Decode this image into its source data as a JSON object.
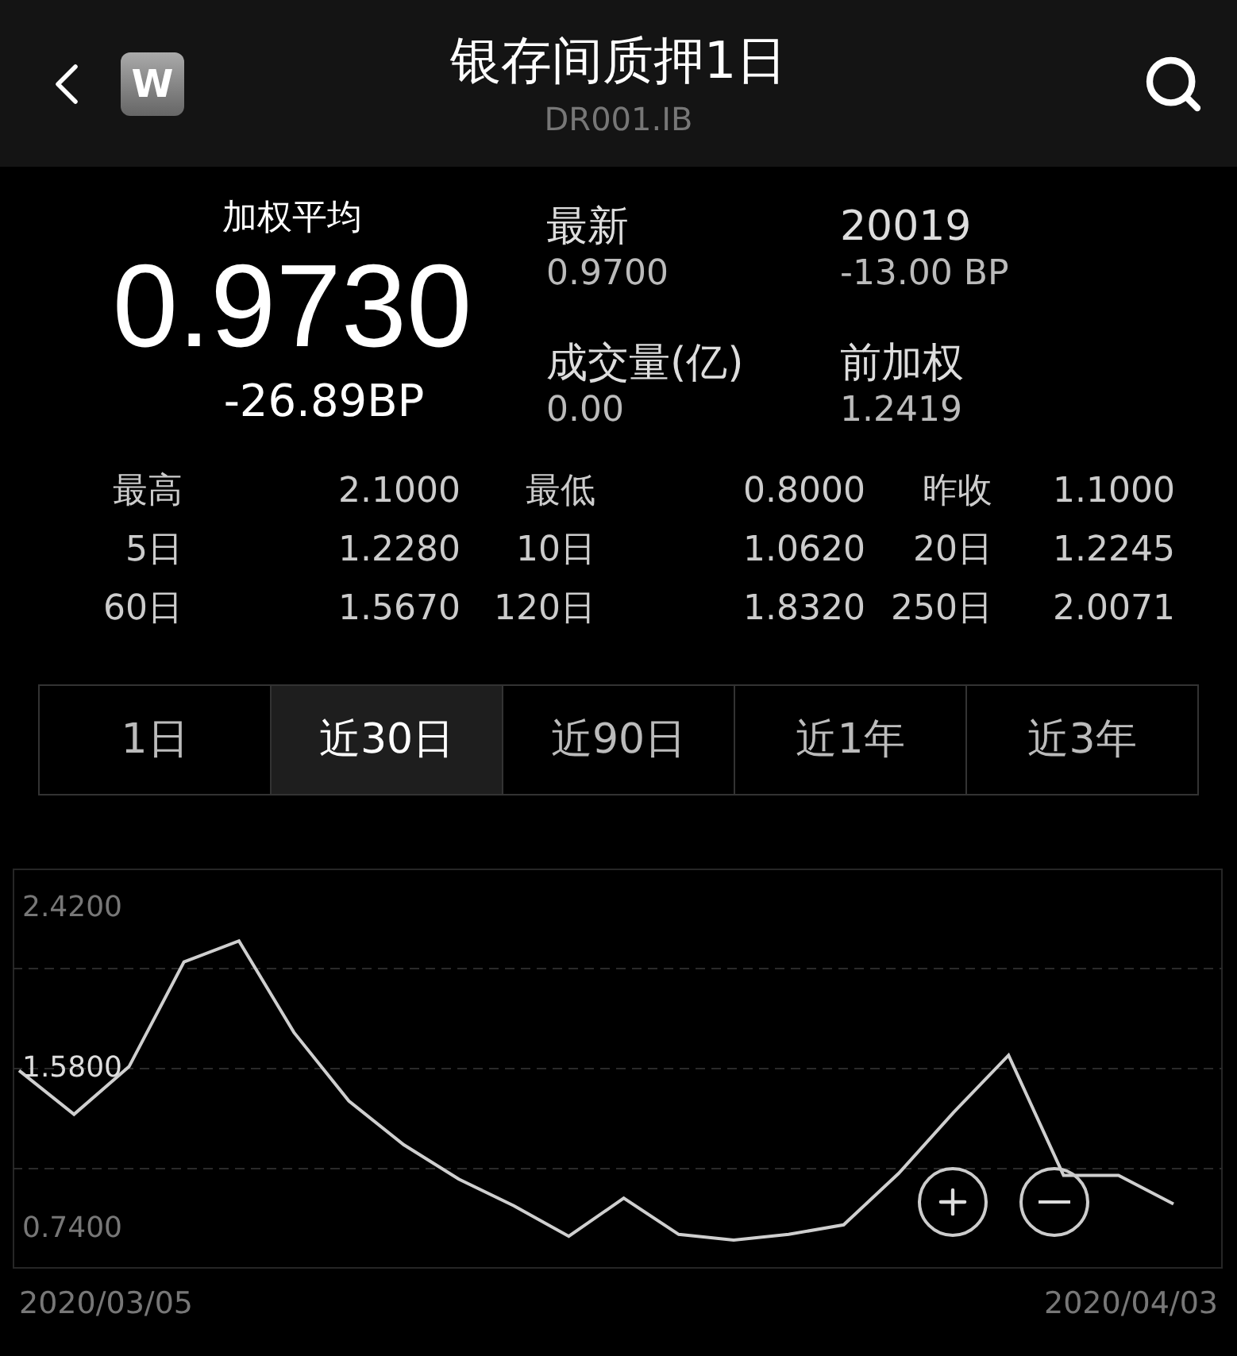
{
  "header": {
    "title": "银存间质押1日",
    "subtitle": "DR001.IB",
    "badge": "W"
  },
  "quote": {
    "label": "加权平均",
    "value": "0.9730",
    "change": "-26.89BP"
  },
  "summary": [
    {
      "label": "最新",
      "value": "0.9700"
    },
    {
      "label": "20019",
      "value": "-13.00 BP"
    },
    {
      "label": "成交量(亿)",
      "value": "0.00"
    },
    {
      "label": "前加权",
      "value": "1.2419"
    }
  ],
  "stats": [
    [
      {
        "label": "最高",
        "value": "2.1000"
      },
      {
        "label": "最低",
        "value": "0.8000"
      },
      {
        "label": "昨收",
        "value": "1.1000"
      }
    ],
    [
      {
        "label": "5日",
        "value": "1.2280"
      },
      {
        "label": "10日",
        "value": "1.0620"
      },
      {
        "label": "20日",
        "value": "1.2245"
      }
    ],
    [
      {
        "label": "60日",
        "value": "1.5670"
      },
      {
        "label": "120日",
        "value": "1.8320"
      },
      {
        "label": "250日",
        "value": "2.0071"
      }
    ]
  ],
  "tabs": [
    {
      "label": "1日",
      "selected": false
    },
    {
      "label": "近30日",
      "selected": true
    },
    {
      "label": "近90日",
      "selected": false
    },
    {
      "label": "近1年",
      "selected": false
    },
    {
      "label": "近3年",
      "selected": false
    }
  ],
  "chart": {
    "axis_dates": [
      "2020/03/05",
      "2020/04/03"
    ],
    "chart_data": {
      "type": "line",
      "ylim": [
        0.53,
        2.63
      ],
      "yticks": [
        {
          "value": 2.42,
          "label": "2.4200"
        },
        {
          "value": 1.58,
          "label": "1.5800"
        },
        {
          "value": 0.74,
          "label": "0.7400"
        }
      ],
      "series": [
        {
          "color": "#cfcfcf",
          "values": [
            1.57,
            1.34,
            1.59,
            2.14,
            2.25,
            1.77,
            1.41,
            1.18,
            1.0,
            0.86,
            0.7,
            0.9,
            0.71,
            0.68,
            0.71,
            0.76,
            1.03,
            1.35,
            1.65,
            1.02,
            1.02,
            0.87
          ]
        }
      ]
    }
  }
}
